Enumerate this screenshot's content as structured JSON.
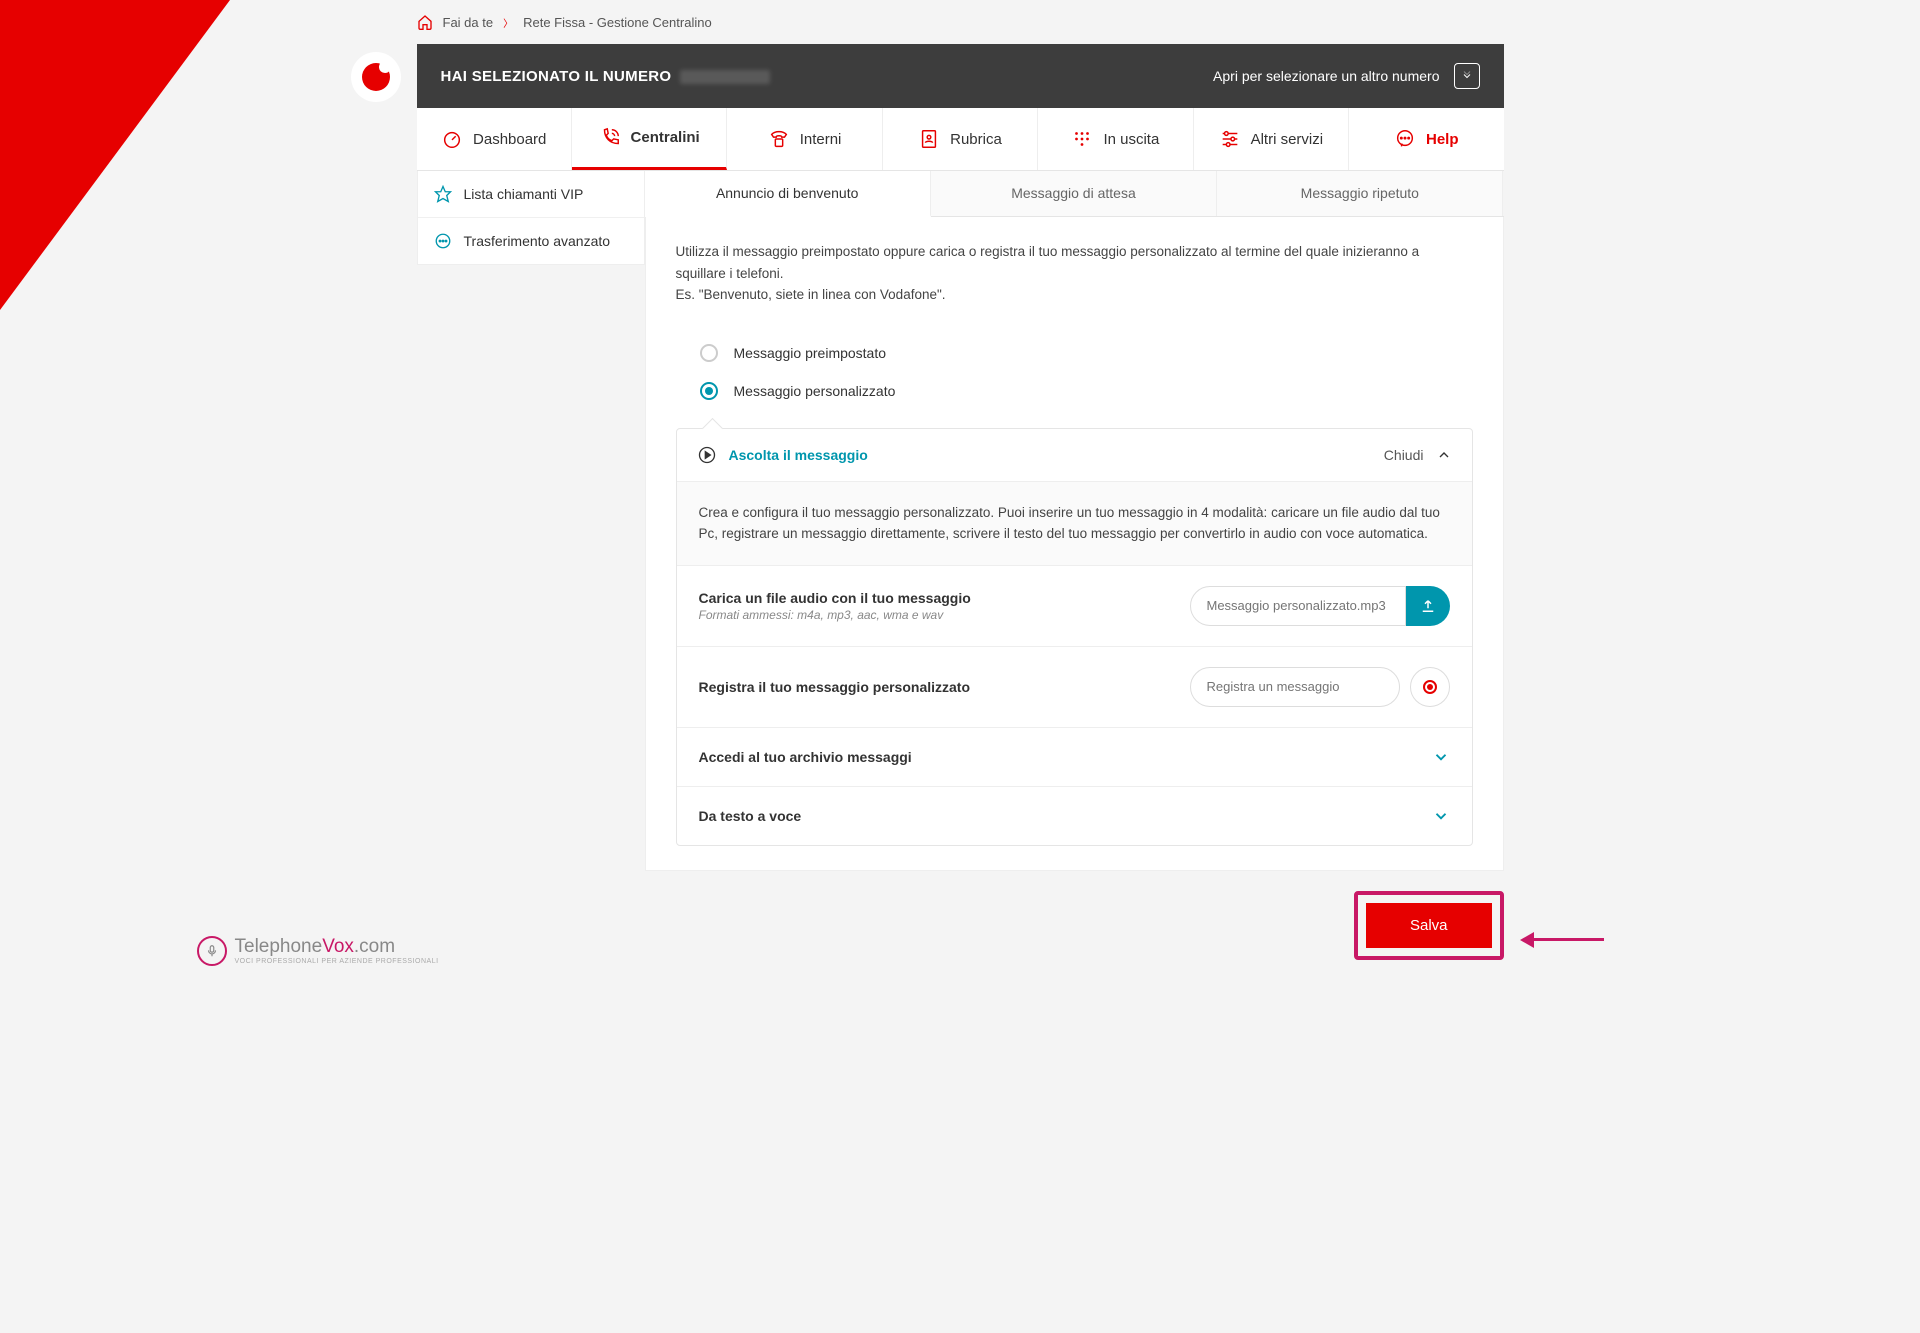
{
  "breadcrumb": {
    "home": "Fai da te",
    "current": "Rete Fissa - Gestione Centralino"
  },
  "header": {
    "label": "HAI SELEZIONATO IL NUMERO",
    "selectOther": "Apri per selezionare un altro numero"
  },
  "tabs": [
    {
      "label": "Dashboard"
    },
    {
      "label": "Centralini"
    },
    {
      "label": "Interni"
    },
    {
      "label": "Rubrica"
    },
    {
      "label": "In uscita"
    },
    {
      "label": "Altri servizi"
    },
    {
      "label": "Help"
    }
  ],
  "sidebar": [
    {
      "label": "Lista chiamanti VIP"
    },
    {
      "label": "Trasferimento avanzato"
    }
  ],
  "subtabs": [
    {
      "label": "Annuncio di benvenuto"
    },
    {
      "label": "Messaggio di attesa"
    },
    {
      "label": "Messaggio ripetuto"
    }
  ],
  "intro": {
    "line1": "Utilizza il messaggio preimpostato oppure carica o registra il tuo messaggio personalizzato al termine del quale inizieranno a squillare i telefoni.",
    "line2": "Es. \"Benvenuto, siete in linea con Vodafone\"."
  },
  "radios": {
    "preset": "Messaggio preimpostato",
    "custom": "Messaggio personalizzato"
  },
  "expand": {
    "listen": "Ascolta il messaggio",
    "close": "Chiudi",
    "desc": "Crea e configura il tuo messaggio personalizzato. Puoi inserire un tuo messaggio in 4 modalità: caricare un file audio dal tuo Pc, registrare un messaggio direttamente, scrivere il testo del tuo messaggio per convertirlo in audio con voce automatica."
  },
  "upload": {
    "label": "Carica un file audio con il tuo messaggio",
    "sublabel": "Formati ammessi: m4a, mp3, aac, wma e wav",
    "placeholder": "Messaggio personalizzato.mp3"
  },
  "record": {
    "label": "Registra il tuo messaggio personalizzato",
    "placeholder": "Registra un messaggio"
  },
  "collapse": {
    "archive": "Accedi al tuo archivio messaggi",
    "tts": "Da testo a voce"
  },
  "save": "Salva",
  "footer": {
    "brand1": "Telephone",
    "brand2": "Vox",
    "brand3": ".com",
    "tagline": "Voci professionali per aziende professionali"
  }
}
